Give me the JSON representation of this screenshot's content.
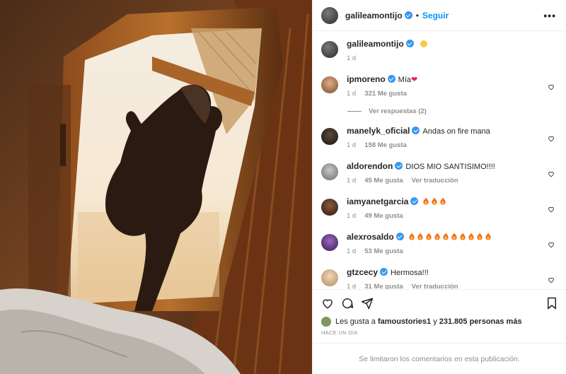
{
  "post": {
    "username": "galileamontijo",
    "follow_label": "Seguir",
    "more_icon": "•••",
    "caption_time": "1 d"
  },
  "comments": [
    {
      "user": "ipmoreno",
      "text": "Mía",
      "emoji": "red-heart",
      "time": "1 d",
      "likes": "321 Me gusta",
      "translate": ""
    },
    {
      "user": "manelyk_oficial",
      "text": "Andas on fire mana",
      "time": "1 d",
      "likes": "158 Me gusta",
      "translate": ""
    },
    {
      "user": "aldorendon",
      "text": "DIOS MIO SANTISIMO!!!!",
      "time": "1 d",
      "likes": "45 Me gusta",
      "translate": "Ver traducción"
    },
    {
      "user": "iamyanetgarcia",
      "text": "",
      "fires": 3,
      "time": "1 d",
      "likes": "49 Me gusta",
      "translate": ""
    },
    {
      "user": "alexrosaldo",
      "text": "",
      "fires": 10,
      "time": "1 d",
      "likes": "53 Me gusta",
      "translate": ""
    },
    {
      "user": "gtzcecy",
      "text": "Hermosa!!!",
      "time": "1 d",
      "likes": "31 Me gusta",
      "translate": "Ver traducción"
    }
  ],
  "replies_label": "Ver respuestas (2)",
  "likes": {
    "prefix": "Les gusta a",
    "user": "famoustories1",
    "middle": "y",
    "count": "231.805 personas más"
  },
  "timestamp": "HACE UN DÍA",
  "comments_closed": "Se limitaron los comentarios en esta publicación.",
  "colors": {
    "accent": "#0095f6",
    "verified": "#3897f0",
    "muted": "#8e8e8e"
  }
}
